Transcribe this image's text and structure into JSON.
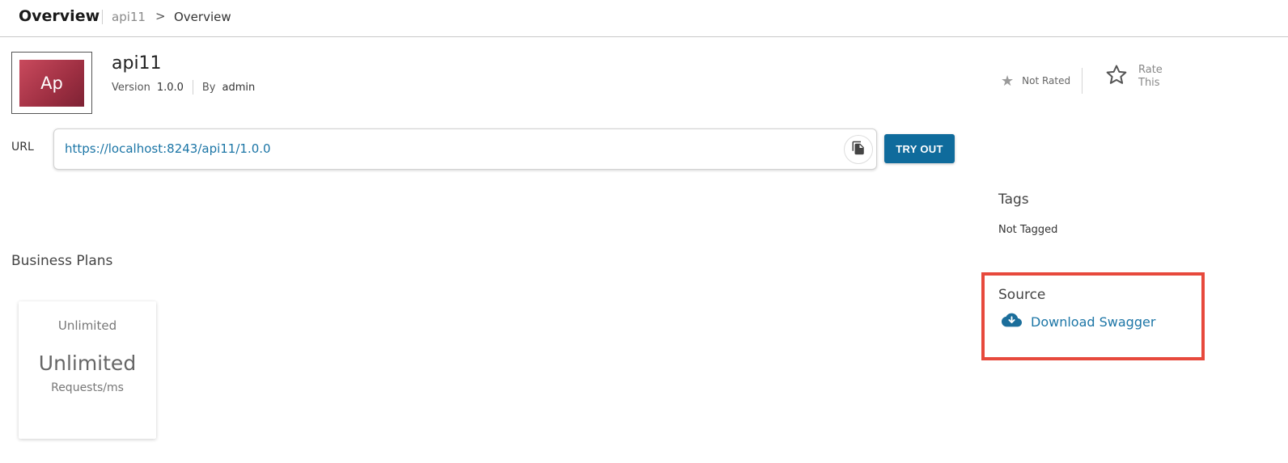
{
  "header": {
    "title": "Overview",
    "breadcrumb": {
      "item1": "api11",
      "separator": ">",
      "item2": "Overview"
    }
  },
  "api": {
    "thumbnail_text": "Ap",
    "name": "api11",
    "version_label": "Version",
    "version": "1.0.0",
    "by_label": "By",
    "owner": "admin"
  },
  "rating": {
    "status": "Not Rated",
    "rate_label_line1": "Rate",
    "rate_label_line2": "This"
  },
  "url": {
    "label": "URL",
    "value": "https://localhost:8243/api11/1.0.0",
    "try_out_label": "TRY OUT"
  },
  "tags": {
    "title": "Tags",
    "value": "Not Tagged"
  },
  "business_plans": {
    "title": "Business Plans",
    "plans": [
      {
        "name": "Unlimited",
        "value": "Unlimited",
        "unit": "Requests/ms"
      }
    ]
  },
  "source": {
    "title": "Source",
    "download_label": "Download Swagger"
  },
  "colors": {
    "accent": "#0f6b9c",
    "link": "#1b75a6",
    "highlight": "#e7493c"
  }
}
